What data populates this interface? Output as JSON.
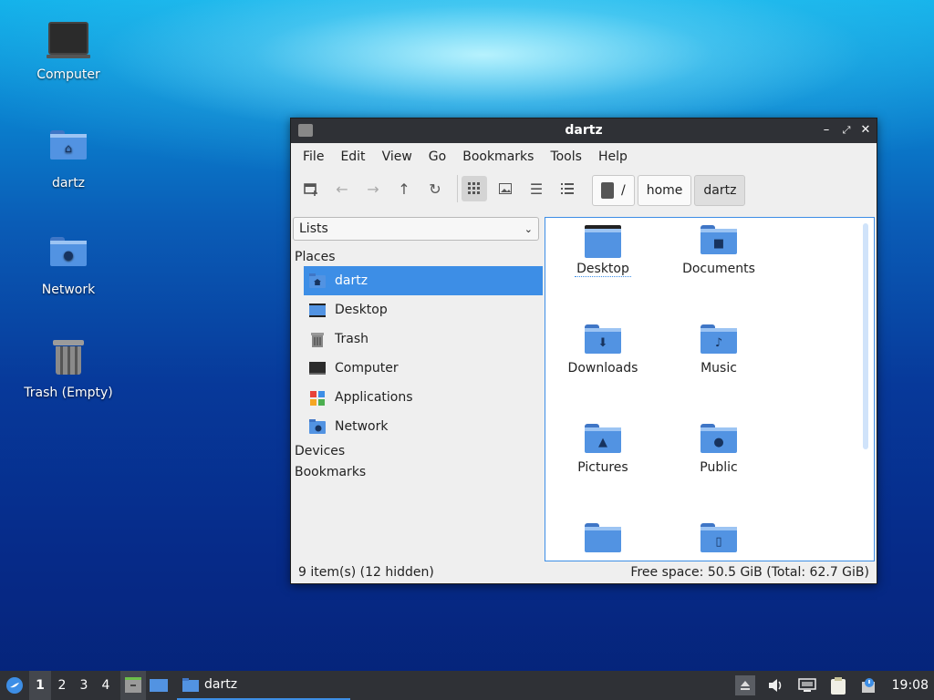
{
  "desktop": {
    "icons": [
      {
        "label": "Computer"
      },
      {
        "label": "dartz"
      },
      {
        "label": "Network"
      },
      {
        "label": "Trash (Empty)"
      }
    ]
  },
  "window": {
    "title": "dartz",
    "menu": [
      "File",
      "Edit",
      "View",
      "Go",
      "Bookmarks",
      "Tools",
      "Help"
    ],
    "breadcrumbs": [
      "/",
      "home",
      "dartz"
    ],
    "sidebar": {
      "combo_value": "Lists",
      "places_header": "Places",
      "places": [
        "dartz",
        "Desktop",
        "Trash",
        "Computer",
        "Applications",
        "Network"
      ],
      "devices_header": "Devices",
      "bookmarks_header": "Bookmarks"
    },
    "files": [
      "Desktop",
      "Documents",
      "Downloads",
      "Music",
      "Pictures",
      "Public",
      "",
      ""
    ],
    "status": {
      "items": "9 item(s) (12 hidden)",
      "free_space": "Free space: 50.5 GiB (Total: 62.7 GiB)"
    }
  },
  "taskbar": {
    "workspaces": [
      "1",
      "2",
      "3",
      "4"
    ],
    "task_label": "dartz",
    "clock": "19:08"
  },
  "colors": {
    "accent": "#3d8ee6",
    "folder": "#5293e2",
    "titlebar": "#2f3136"
  }
}
